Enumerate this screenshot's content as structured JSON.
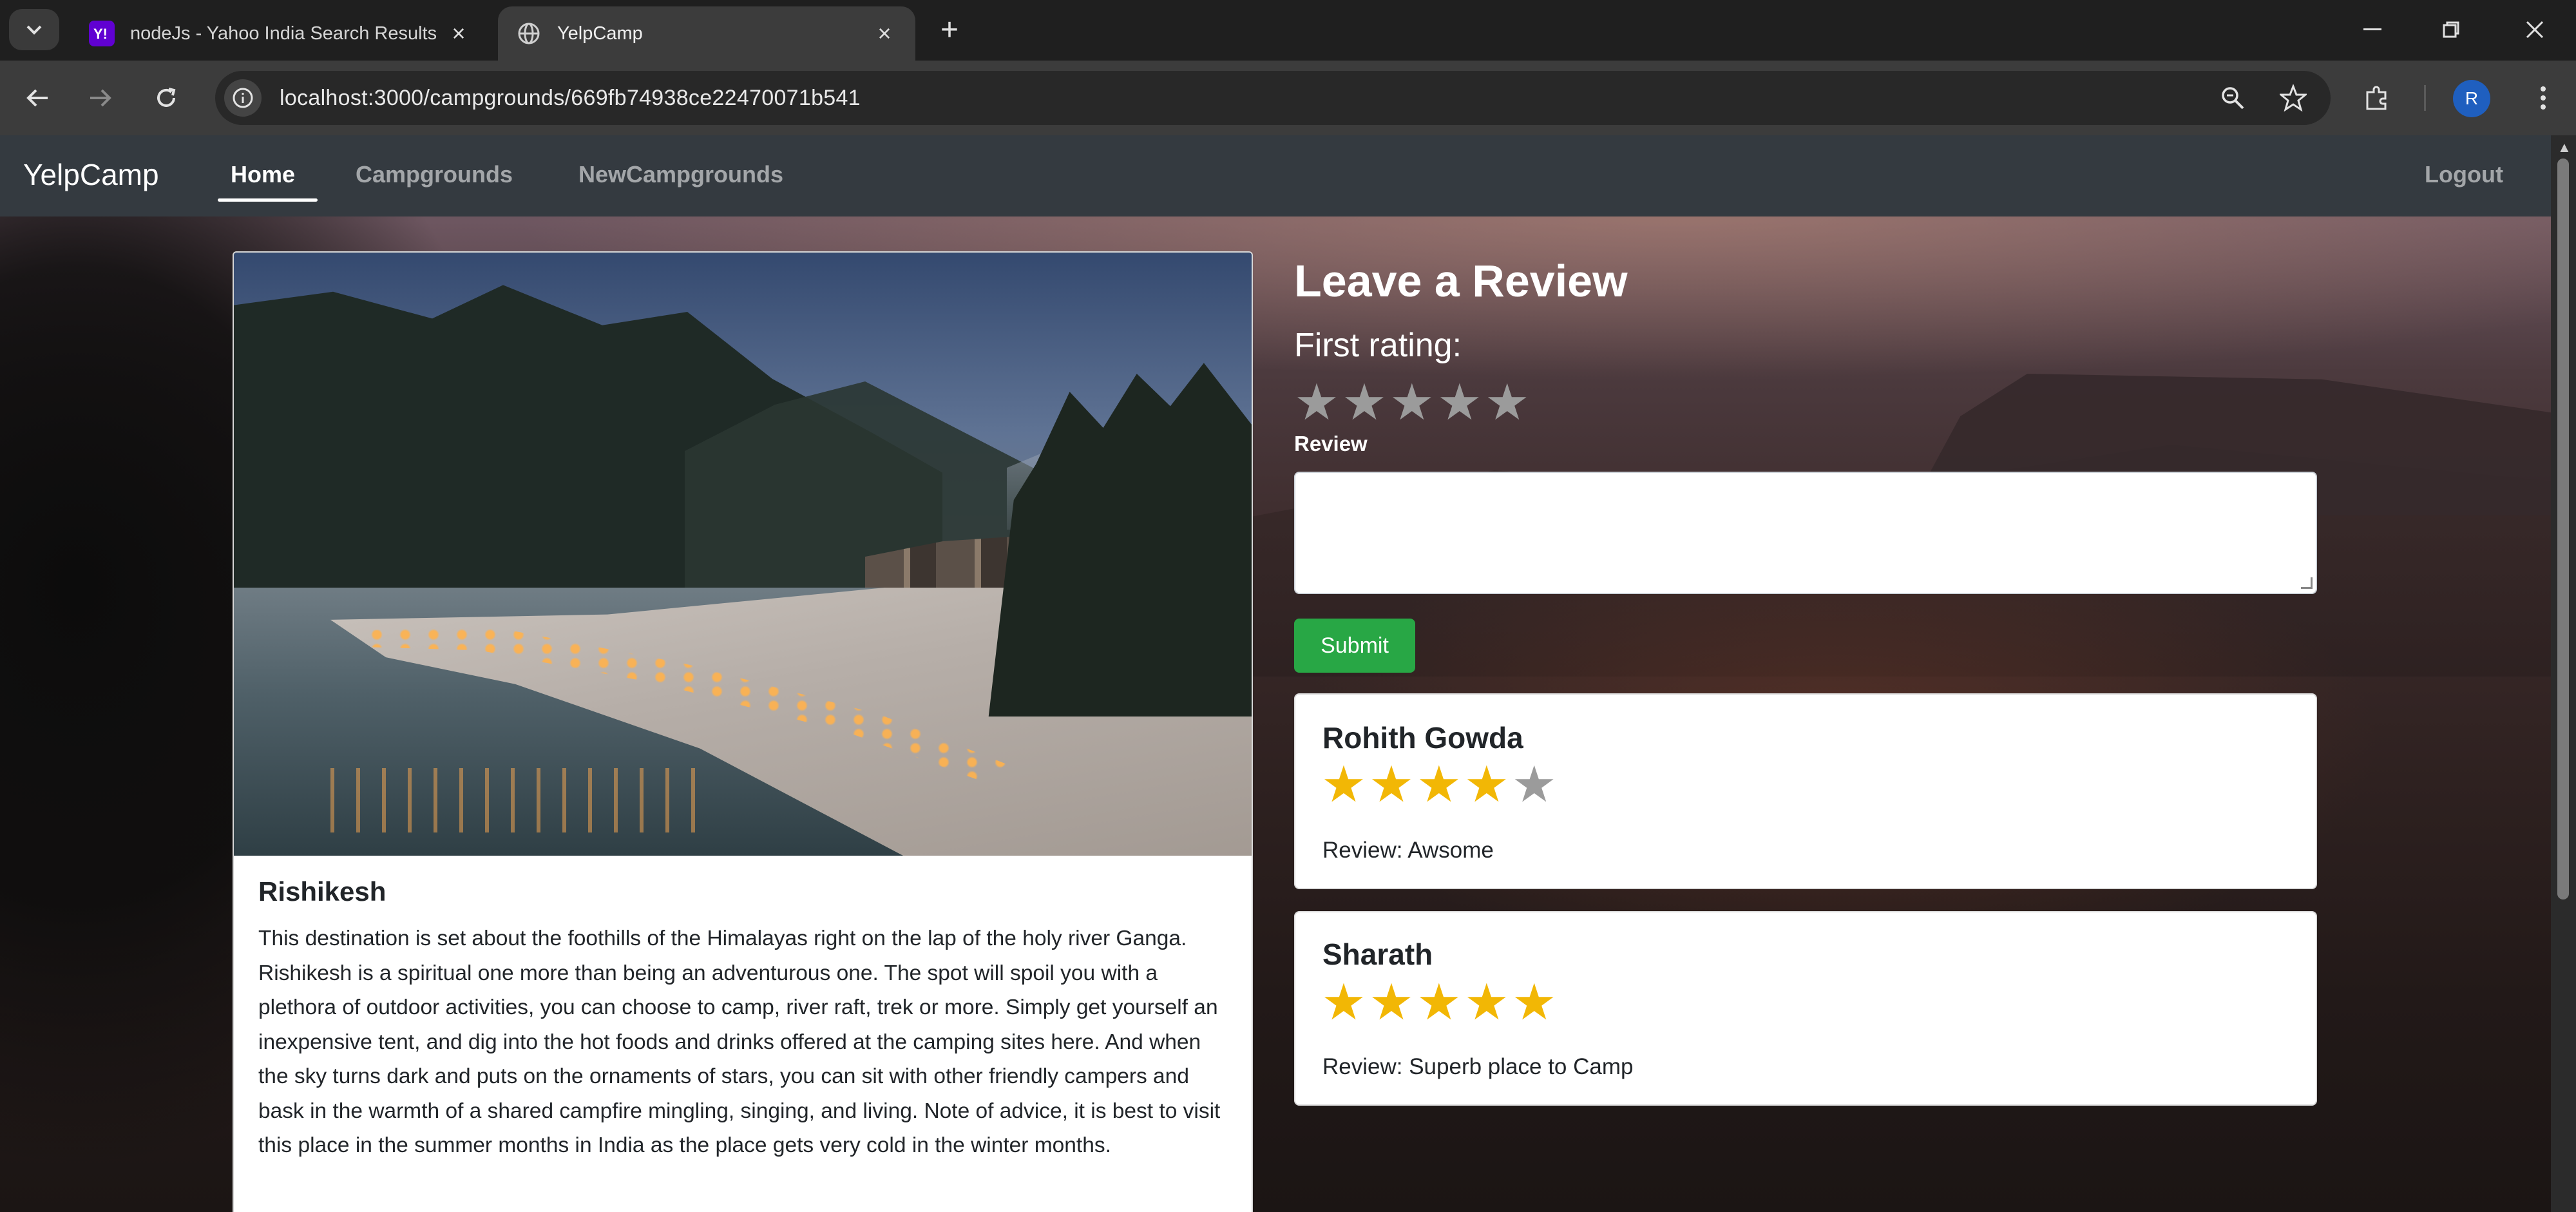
{
  "browser": {
    "tabs": [
      {
        "title": "nodeJs - Yahoo India Search Results",
        "active": false,
        "icon": "yahoo-icon"
      },
      {
        "title": "YelpCamp",
        "active": true,
        "icon": "globe-icon"
      }
    ],
    "url": "localhost:3000/campgrounds/669fb74938ce22470071b541",
    "profile_initial": "R"
  },
  "navbar": {
    "brand": "YelpCamp",
    "links": [
      {
        "label": "Home",
        "active": true
      },
      {
        "label": "Campgrounds",
        "active": false
      },
      {
        "label": "NewCampgrounds",
        "active": false
      }
    ],
    "logout": "Logout"
  },
  "campground": {
    "title": "Rishikesh",
    "description": "This destination is set about the foothills of the Himalayas right on the lap of the holy river Ganga. Rishikesh is a spiritual one more than being an adventurous one. The spot will spoil you with a plethora of outdoor activities, you can choose to camp, river raft, trek or more. Simply get yourself an inexpensive tent, and dig into the hot foods and drinks offered at the camping sites here. And when the sky turns dark and puts on the ornaments of stars, you can sit with other friendly campers and bask in the warmth of a shared campfire mingling, singing, and living. Note of advice, it is best to visit this place in the summer months in India as the place gets very cold in the winter months."
  },
  "review_form": {
    "heading": "Leave a Review",
    "rating_label": "First rating:",
    "rating_max": 5,
    "rating_value": 0,
    "review_label": "Review",
    "review_value": "",
    "submit_label": "Submit"
  },
  "reviews": [
    {
      "author": "Rohith Gowda",
      "rating": 4,
      "max": 5,
      "text": "Review: Awsome"
    },
    {
      "author": "Sharath",
      "rating": 5,
      "max": 5,
      "text": "Review: Superb place to Camp"
    }
  ],
  "colors": {
    "navbar_bg": "#343a40",
    "submit_green": "#28a745",
    "star_filled": "#f2b705",
    "star_empty": "#9b9b9b"
  }
}
